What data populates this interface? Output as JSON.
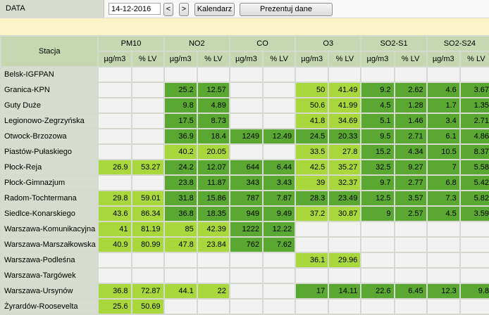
{
  "toolbar": {
    "date_label": "DATA",
    "date_value": "14-12-2016",
    "prev_label": "<",
    "next_label": ">",
    "calendar_label": "Kalendarz",
    "present_label": "Prezentuj dane"
  },
  "table": {
    "station_header": "Stacja",
    "pollutants": [
      "PM10",
      "NO2",
      "CO",
      "O3",
      "SO2-S1",
      "SO2-S24"
    ],
    "unit_labels": [
      "µg/m3",
      "% LV"
    ],
    "rows": [
      {
        "station": "Belsk-IGFPAN",
        "cells": [
          {
            "v": "",
            "c": "e"
          },
          {
            "v": "",
            "c": "e"
          },
          {
            "v": "",
            "c": "e"
          },
          {
            "v": "",
            "c": "e"
          },
          {
            "v": "",
            "c": "e"
          },
          {
            "v": "",
            "c": "e"
          },
          {
            "v": "",
            "c": "e"
          },
          {
            "v": "",
            "c": "e"
          },
          {
            "v": "",
            "c": "e"
          },
          {
            "v": "",
            "c": "e"
          },
          {
            "v": "",
            "c": "e"
          },
          {
            "v": "",
            "c": "e"
          }
        ]
      },
      {
        "station": "Granica-KPN",
        "cells": [
          {
            "v": "",
            "c": "e"
          },
          {
            "v": "",
            "c": "e"
          },
          {
            "v": "25.2",
            "c": "g"
          },
          {
            "v": "12.57",
            "c": "g"
          },
          {
            "v": "",
            "c": "e"
          },
          {
            "v": "",
            "c": "e"
          },
          {
            "v": "50",
            "c": "lg"
          },
          {
            "v": "41.49",
            "c": "lg"
          },
          {
            "v": "9.2",
            "c": "g"
          },
          {
            "v": "2.62",
            "c": "g"
          },
          {
            "v": "4.6",
            "c": "g"
          },
          {
            "v": "3.67",
            "c": "g"
          }
        ]
      },
      {
        "station": "Guty Duże",
        "cells": [
          {
            "v": "",
            "c": "e"
          },
          {
            "v": "",
            "c": "e"
          },
          {
            "v": "9.8",
            "c": "g"
          },
          {
            "v": "4.89",
            "c": "g"
          },
          {
            "v": "",
            "c": "e"
          },
          {
            "v": "",
            "c": "e"
          },
          {
            "v": "50.6",
            "c": "lg"
          },
          {
            "v": "41.99",
            "c": "lg"
          },
          {
            "v": "4.5",
            "c": "g"
          },
          {
            "v": "1.28",
            "c": "g"
          },
          {
            "v": "1.7",
            "c": "g"
          },
          {
            "v": "1.35",
            "c": "g"
          }
        ]
      },
      {
        "station": "Legionowo-Zegrzyńska",
        "cells": [
          {
            "v": "",
            "c": "e"
          },
          {
            "v": "",
            "c": "e"
          },
          {
            "v": "17.5",
            "c": "g"
          },
          {
            "v": "8.73",
            "c": "g"
          },
          {
            "v": "",
            "c": "e"
          },
          {
            "v": "",
            "c": "e"
          },
          {
            "v": "41.8",
            "c": "lg"
          },
          {
            "v": "34.69",
            "c": "lg"
          },
          {
            "v": "5.1",
            "c": "g"
          },
          {
            "v": "1.46",
            "c": "g"
          },
          {
            "v": "3.4",
            "c": "g"
          },
          {
            "v": "2.71",
            "c": "g"
          }
        ]
      },
      {
        "station": "Otwock-Brzozowa",
        "cells": [
          {
            "v": "",
            "c": "e"
          },
          {
            "v": "",
            "c": "e"
          },
          {
            "v": "36.9",
            "c": "g"
          },
          {
            "v": "18.4",
            "c": "g"
          },
          {
            "v": "1249",
            "c": "g"
          },
          {
            "v": "12.49",
            "c": "g"
          },
          {
            "v": "24.5",
            "c": "g"
          },
          {
            "v": "20.33",
            "c": "g"
          },
          {
            "v": "9.5",
            "c": "g"
          },
          {
            "v": "2.71",
            "c": "g"
          },
          {
            "v": "6.1",
            "c": "g"
          },
          {
            "v": "4.86",
            "c": "g"
          }
        ]
      },
      {
        "station": "Piastów-Pułaskiego",
        "cells": [
          {
            "v": "",
            "c": "e"
          },
          {
            "v": "",
            "c": "e"
          },
          {
            "v": "40.2",
            "c": "lg"
          },
          {
            "v": "20.05",
            "c": "lg"
          },
          {
            "v": "",
            "c": "e"
          },
          {
            "v": "",
            "c": "e"
          },
          {
            "v": "33.5",
            "c": "lg"
          },
          {
            "v": "27.8",
            "c": "lg"
          },
          {
            "v": "15.2",
            "c": "g"
          },
          {
            "v": "4.34",
            "c": "g"
          },
          {
            "v": "10.5",
            "c": "g"
          },
          {
            "v": "8.37",
            "c": "g"
          }
        ]
      },
      {
        "station": "Płock-Reja",
        "cells": [
          {
            "v": "26.9",
            "c": "lg"
          },
          {
            "v": "53.27",
            "c": "lg"
          },
          {
            "v": "24.2",
            "c": "g"
          },
          {
            "v": "12.07",
            "c": "g"
          },
          {
            "v": "644",
            "c": "g"
          },
          {
            "v": "6.44",
            "c": "g"
          },
          {
            "v": "42.5",
            "c": "lg"
          },
          {
            "v": "35.27",
            "c": "lg"
          },
          {
            "v": "32.5",
            "c": "g"
          },
          {
            "v": "9.27",
            "c": "g"
          },
          {
            "v": "7",
            "c": "g"
          },
          {
            "v": "5.58",
            "c": "g"
          }
        ]
      },
      {
        "station": "Płock-Gimnazjum",
        "cells": [
          {
            "v": "",
            "c": "e"
          },
          {
            "v": "",
            "c": "e"
          },
          {
            "v": "23.8",
            "c": "g"
          },
          {
            "v": "11.87",
            "c": "g"
          },
          {
            "v": "343",
            "c": "g"
          },
          {
            "v": "3.43",
            "c": "g"
          },
          {
            "v": "39",
            "c": "lg"
          },
          {
            "v": "32.37",
            "c": "lg"
          },
          {
            "v": "9.7",
            "c": "g"
          },
          {
            "v": "2.77",
            "c": "g"
          },
          {
            "v": "6.8",
            "c": "g"
          },
          {
            "v": "5.42",
            "c": "g"
          }
        ]
      },
      {
        "station": "Radom-Tochtermana",
        "cells": [
          {
            "v": "29.8",
            "c": "lg"
          },
          {
            "v": "59.01",
            "c": "lg"
          },
          {
            "v": "31.8",
            "c": "g"
          },
          {
            "v": "15.86",
            "c": "g"
          },
          {
            "v": "787",
            "c": "g"
          },
          {
            "v": "7.87",
            "c": "g"
          },
          {
            "v": "28.3",
            "c": "g"
          },
          {
            "v": "23.49",
            "c": "g"
          },
          {
            "v": "12.5",
            "c": "g"
          },
          {
            "v": "3.57",
            "c": "g"
          },
          {
            "v": "7.3",
            "c": "g"
          },
          {
            "v": "5.82",
            "c": "g"
          }
        ]
      },
      {
        "station": "Siedlce-Konarskiego",
        "cells": [
          {
            "v": "43.6",
            "c": "lg"
          },
          {
            "v": "86.34",
            "c": "lg"
          },
          {
            "v": "36.8",
            "c": "g"
          },
          {
            "v": "18.35",
            "c": "g"
          },
          {
            "v": "949",
            "c": "g"
          },
          {
            "v": "9.49",
            "c": "g"
          },
          {
            "v": "37.2",
            "c": "lg"
          },
          {
            "v": "30.87",
            "c": "lg"
          },
          {
            "v": "9",
            "c": "g"
          },
          {
            "v": "2.57",
            "c": "g"
          },
          {
            "v": "4.5",
            "c": "g"
          },
          {
            "v": "3.59",
            "c": "g"
          }
        ]
      },
      {
        "station": "Warszawa-Komunikacyjna",
        "cells": [
          {
            "v": "41",
            "c": "lg"
          },
          {
            "v": "81.19",
            "c": "lg"
          },
          {
            "v": "85",
            "c": "lg"
          },
          {
            "v": "42.39",
            "c": "lg"
          },
          {
            "v": "1222",
            "c": "g"
          },
          {
            "v": "12.22",
            "c": "g"
          },
          {
            "v": "",
            "c": "e"
          },
          {
            "v": "",
            "c": "e"
          },
          {
            "v": "",
            "c": "e"
          },
          {
            "v": "",
            "c": "e"
          },
          {
            "v": "",
            "c": "e"
          },
          {
            "v": "",
            "c": "e"
          }
        ]
      },
      {
        "station": "Warszawa-Marszałkowska",
        "cells": [
          {
            "v": "40.9",
            "c": "lg"
          },
          {
            "v": "80.99",
            "c": "lg"
          },
          {
            "v": "47.8",
            "c": "lg"
          },
          {
            "v": "23.84",
            "c": "lg"
          },
          {
            "v": "762",
            "c": "g"
          },
          {
            "v": "7.62",
            "c": "g"
          },
          {
            "v": "",
            "c": "e"
          },
          {
            "v": "",
            "c": "e"
          },
          {
            "v": "",
            "c": "e"
          },
          {
            "v": "",
            "c": "e"
          },
          {
            "v": "",
            "c": "e"
          },
          {
            "v": "",
            "c": "e"
          }
        ]
      },
      {
        "station": "Warszawa-Podleśna",
        "cells": [
          {
            "v": "",
            "c": "e"
          },
          {
            "v": "",
            "c": "e"
          },
          {
            "v": "",
            "c": "e"
          },
          {
            "v": "",
            "c": "e"
          },
          {
            "v": "",
            "c": "e"
          },
          {
            "v": "",
            "c": "e"
          },
          {
            "v": "36.1",
            "c": "lg"
          },
          {
            "v": "29.96",
            "c": "lg"
          },
          {
            "v": "",
            "c": "e"
          },
          {
            "v": "",
            "c": "e"
          },
          {
            "v": "",
            "c": "e"
          },
          {
            "v": "",
            "c": "e"
          }
        ]
      },
      {
        "station": "Warszawa-Targówek",
        "cells": [
          {
            "v": "",
            "c": "e"
          },
          {
            "v": "",
            "c": "e"
          },
          {
            "v": "",
            "c": "e"
          },
          {
            "v": "",
            "c": "e"
          },
          {
            "v": "",
            "c": "e"
          },
          {
            "v": "",
            "c": "e"
          },
          {
            "v": "",
            "c": "e"
          },
          {
            "v": "",
            "c": "e"
          },
          {
            "v": "",
            "c": "e"
          },
          {
            "v": "",
            "c": "e"
          },
          {
            "v": "",
            "c": "e"
          },
          {
            "v": "",
            "c": "e"
          }
        ]
      },
      {
        "station": "Warszawa-Ursynów",
        "cells": [
          {
            "v": "36.8",
            "c": "lg"
          },
          {
            "v": "72.87",
            "c": "lg"
          },
          {
            "v": "44.1",
            "c": "lg"
          },
          {
            "v": "22",
            "c": "lg"
          },
          {
            "v": "",
            "c": "e"
          },
          {
            "v": "",
            "c": "e"
          },
          {
            "v": "17",
            "c": "g"
          },
          {
            "v": "14.11",
            "c": "g"
          },
          {
            "v": "22.6",
            "c": "g"
          },
          {
            "v": "6.45",
            "c": "g"
          },
          {
            "v": "12.3",
            "c": "g"
          },
          {
            "v": "9.8",
            "c": "g"
          }
        ]
      },
      {
        "station": "Żyrardów-Roosevelta",
        "cells": [
          {
            "v": "25.6",
            "c": "lg"
          },
          {
            "v": "50.69",
            "c": "lg"
          },
          {
            "v": "",
            "c": "e"
          },
          {
            "v": "",
            "c": "e"
          },
          {
            "v": "",
            "c": "e"
          },
          {
            "v": "",
            "c": "e"
          },
          {
            "v": "",
            "c": "e"
          },
          {
            "v": "",
            "c": "e"
          },
          {
            "v": "",
            "c": "e"
          },
          {
            "v": "",
            "c": "e"
          },
          {
            "v": "",
            "c": "e"
          },
          {
            "v": "",
            "c": "e"
          }
        ]
      }
    ]
  },
  "colors": {
    "good": "#5aa832",
    "moderate": "#a8d83c",
    "empty": "#f2f2f2",
    "header": "#c7d7b1"
  }
}
